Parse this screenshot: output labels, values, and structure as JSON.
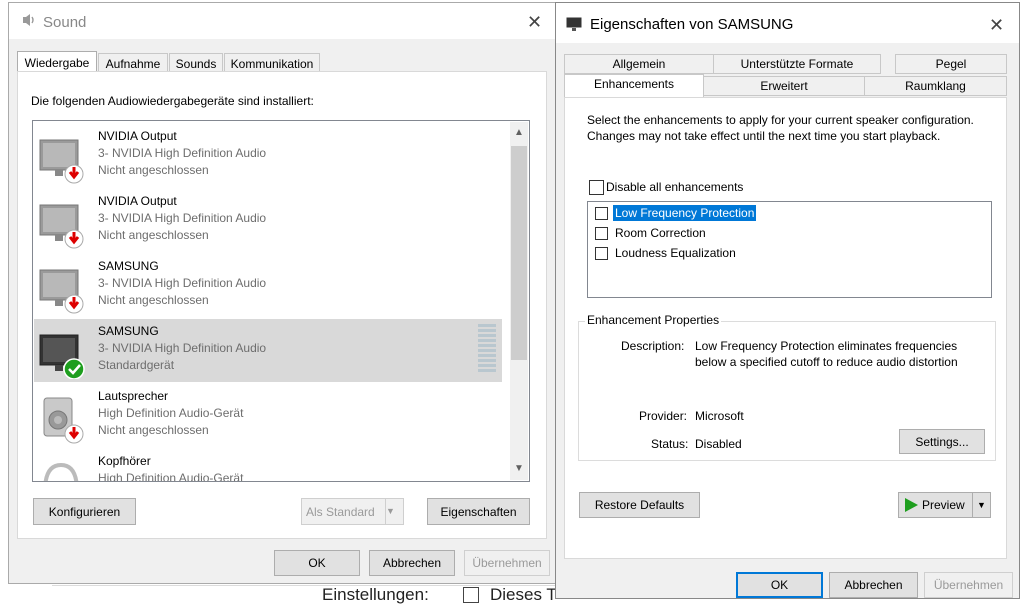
{
  "background": {
    "footer_left_label": "Einstellungen:",
    "footer_checkbox_label": "Dieses T"
  },
  "sound_dialog": {
    "title": "Sound",
    "tabs": [
      "Wiedergabe",
      "Aufnahme",
      "Sounds",
      "Kommunikation"
    ],
    "active_tab": "Wiedergabe",
    "instruction": "Die folgenden Audiowiedergabegeräte sind installiert:",
    "devices": [
      {
        "name": "NVIDIA Output",
        "driver": "3- NVIDIA High Definition Audio",
        "status": "Nicht angeschlossen",
        "icon": "monitor-disconnected-icon",
        "selected": false
      },
      {
        "name": "NVIDIA Output",
        "driver": "3- NVIDIA High Definition Audio",
        "status": "Nicht angeschlossen",
        "icon": "monitor-disconnected-icon",
        "selected": false
      },
      {
        "name": "SAMSUNG",
        "driver": "3- NVIDIA High Definition Audio",
        "status": "Nicht angeschlossen",
        "icon": "monitor-disconnected-icon",
        "selected": false
      },
      {
        "name": "SAMSUNG",
        "driver": "3- NVIDIA High Definition Audio",
        "status": "Standardgerät",
        "icon": "monitor-default-check-icon",
        "selected": true
      },
      {
        "name": "Lautsprecher",
        "driver": "High Definition Audio-Gerät",
        "status": "Nicht angeschlossen",
        "icon": "speaker-disconnected-icon",
        "selected": false
      },
      {
        "name": "Kopfhörer",
        "driver": "High Definition Audio-Gerät",
        "status": "",
        "icon": "headphones-icon",
        "selected": false
      }
    ],
    "buttons": {
      "configure": "Konfigurieren",
      "set_default": "Als Standard",
      "properties": "Eigenschaften",
      "ok": "OK",
      "cancel": "Abbrechen",
      "apply": "Übernehmen"
    }
  },
  "properties_dialog": {
    "title": "Eigenschaften von SAMSUNG",
    "tabs_row1": [
      "Allgemein",
      "Unterstützte Formate",
      "Pegel"
    ],
    "tabs_row2": [
      "Enhancements",
      "Erweitert",
      "Raumklang"
    ],
    "active_tab": "Enhancements",
    "description_text": "Select the enhancements to apply for your current speaker configuration. Changes may not take effect until the next time you start playback.",
    "disable_all_label": "Disable all enhancements",
    "enhancements": [
      {
        "label": "Low Frequency Protection",
        "checked": false,
        "selected": true
      },
      {
        "label": "Room Correction",
        "checked": false,
        "selected": false
      },
      {
        "label": "Loudness Equalization",
        "checked": false,
        "selected": false
      }
    ],
    "properties_group": {
      "title": "Enhancement Properties",
      "description_label": "Description:",
      "description_line1": "Low Frequency Protection eliminates frequencies",
      "description_line2": "below a specified cutoff to reduce audio distortion",
      "provider_label": "Provider:",
      "provider_value": "Microsoft",
      "status_label": "Status:",
      "status_value": "Disabled",
      "settings_button": "Settings..."
    },
    "buttons": {
      "restore_defaults": "Restore Defaults",
      "preview": "Preview",
      "ok": "OK",
      "cancel": "Abbrechen",
      "apply": "Übernehmen"
    },
    "colors": {
      "selection": "#0078d7",
      "preview_play": "#1e9e1e"
    }
  }
}
